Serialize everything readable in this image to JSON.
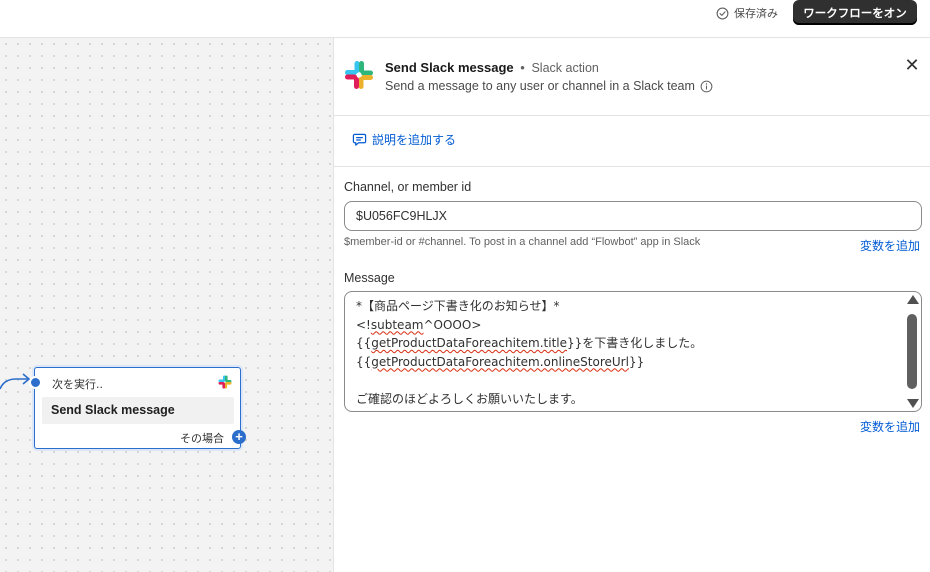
{
  "topbar": {
    "saved_label": "保存済み",
    "turn_on_label": "ワークフローをオン"
  },
  "canvas": {
    "node": {
      "label": "次を実行..",
      "title": "Send Slack message",
      "condition_label": "その場合",
      "plus_symbol": "+"
    }
  },
  "panel": {
    "title": "Send Slack message",
    "separator": "•",
    "subtitle": "Slack action",
    "description": "Send a message to any user or channel in a Slack team",
    "close_symbol": "✕",
    "add_description_label": "説明を追加する",
    "channel": {
      "label": "Channel, or member id",
      "value": "$U056FC9HLJX",
      "help": "$member-id or #channel. To post in a channel add “Flowbot” app in Slack",
      "add_variable_label": "変数を追加"
    },
    "message": {
      "label": "Message",
      "line1": "*【商品ページ下書き化のお知らせ】*",
      "line2_prefix": "<!",
      "line2_token": "subteam",
      "line2_suffix": "^OOOO>",
      "line3_open": "{{",
      "line3_token": "getProductDataForeachitem.title",
      "line3_suffix": "}}を下書き化しました。",
      "line4_open": "{{",
      "line4_token": "getProductDataForeachitem.onlineStoreUrl",
      "line4_suffix": "}}",
      "line5": "",
      "line6": "ご確認のほどよろしくお願いいたします。",
      "add_variable_label": "変数を追加"
    }
  },
  "colors": {
    "accent": "#2c6ecb",
    "link": "#005bd3",
    "primary_button": "#303030",
    "spellcheck": "#d72c0d",
    "slack_green": "#2eb67d",
    "slack_blue": "#36c5f0",
    "slack_red": "#e01e5a",
    "slack_yellow": "#ecb22e"
  },
  "icons": [
    "check-circle-icon",
    "slack-logo-icon",
    "info-icon",
    "close-icon",
    "comment-add-icon",
    "arrow-right-icon",
    "plus-icon",
    "scroll-arrow-up-icon",
    "scroll-arrow-down-icon"
  ]
}
